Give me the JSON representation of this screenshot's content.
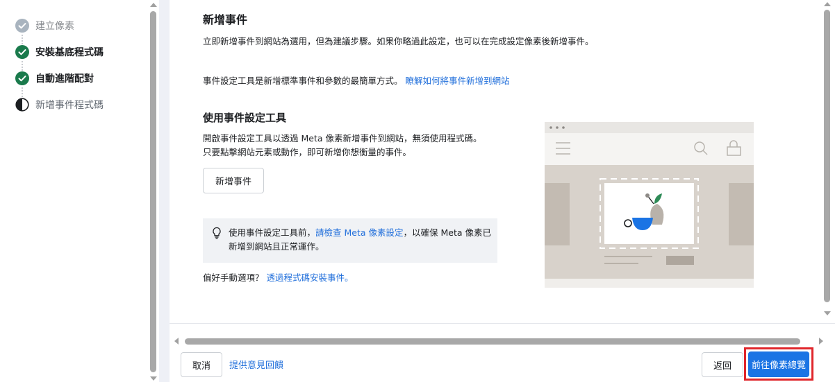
{
  "steps": [
    {
      "label": "建立像素",
      "state": "muted"
    },
    {
      "label": "安裝基底程式碼",
      "state": "done"
    },
    {
      "label": "自動進階配對",
      "state": "done"
    },
    {
      "label": "新增事件程式碼",
      "state": "active"
    }
  ],
  "main": {
    "title": "新增事件",
    "intro": "立即新增事件到網站為選用，但為建議步驟。如果你略過此設定，也可以在完成設定像素後新增事件。",
    "tool_note": "事件設定工具是新增標準事件和參數的最簡單方式。",
    "tool_note_link": "瞭解如何將事件新增到網站",
    "section_title": "使用事件設定工具",
    "section_desc": "開啟事件設定工具以透過 Meta 像素新增事件到網站，無須使用程式碼。只要點擊網站元素或動作，即可新增你想衡量的事件。",
    "add_event_button": "新增事件",
    "tip_prefix": "使用事件設定工具前，",
    "tip_link": "請檢查 Meta 像素設定",
    "tip_suffix": "，以確保 Meta 像素已新增到網站且正常運作。",
    "manual_prefix": "偏好手動選項？",
    "manual_link": "透過程式碼安裝事件。"
  },
  "footer": {
    "cancel": "取消",
    "feedback": "提供意見回饋",
    "back": "返回",
    "primary": "前往像素總覽"
  },
  "colors": {
    "accent": "#1b74e4",
    "link": "#216fdb",
    "success": "#1a7a4c",
    "highlight": "#e0262b"
  }
}
